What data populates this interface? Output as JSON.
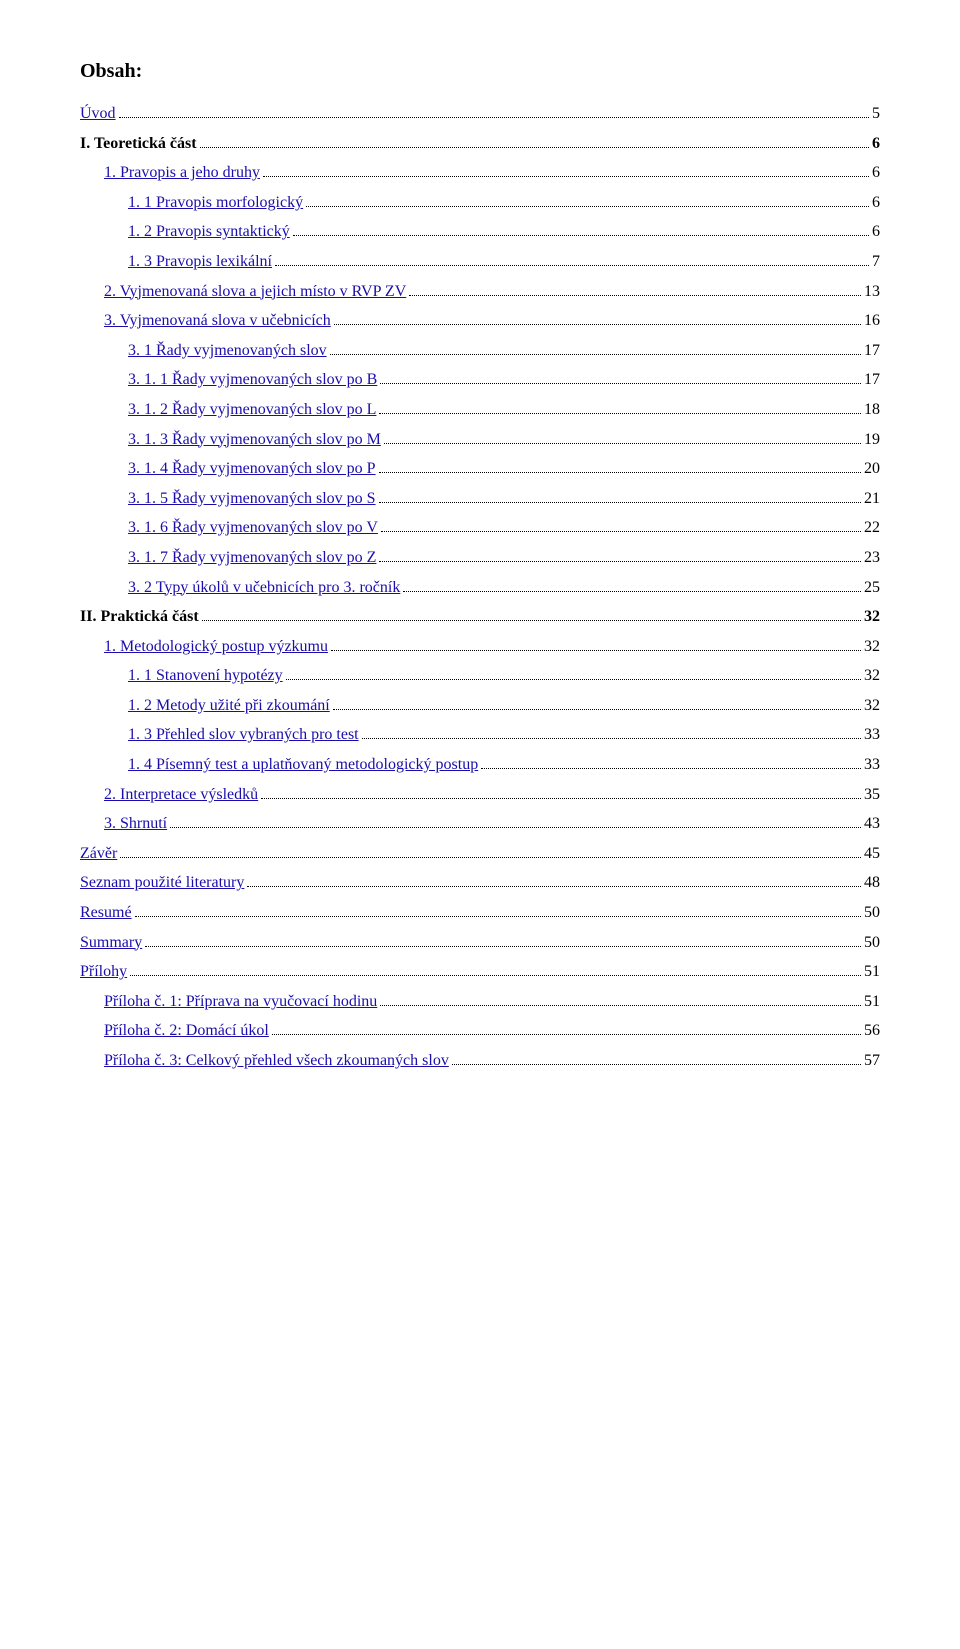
{
  "heading": "Obsah:",
  "entries": [
    {
      "label": "Úvod",
      "page": "5",
      "indent": 0,
      "bold": false,
      "link": true
    },
    {
      "label": "I. Teoretická část",
      "page": "6",
      "indent": 0,
      "bold": true,
      "link": false
    },
    {
      "label": "1. Pravopis a jeho druhy",
      "page": "6",
      "indent": 1,
      "bold": false,
      "link": true
    },
    {
      "label": "1. 1 Pravopis morfologický",
      "page": "6",
      "indent": 2,
      "bold": false,
      "link": true
    },
    {
      "label": "1. 2 Pravopis syntaktický",
      "page": "6",
      "indent": 2,
      "bold": false,
      "link": true
    },
    {
      "label": "1. 3 Pravopis lexikální",
      "page": "7",
      "indent": 2,
      "bold": false,
      "link": true
    },
    {
      "label": "2. Vyjmenovaná slova a jejich místo v RVP ZV",
      "page": "13",
      "indent": 1,
      "bold": false,
      "link": true
    },
    {
      "label": "3. Vyjmenovaná slova v učebnicích",
      "page": "16",
      "indent": 1,
      "bold": false,
      "link": true
    },
    {
      "label": "3. 1 Řady vyjmenovaných slov",
      "page": "17",
      "indent": 2,
      "bold": false,
      "link": true
    },
    {
      "label": "3. 1. 1 Řady vyjmenovaných slov po B",
      "page": "17",
      "indent": 2,
      "bold": false,
      "link": true
    },
    {
      "label": "3. 1. 2 Řady vyjmenovaných slov po L",
      "page": "18",
      "indent": 2,
      "bold": false,
      "link": true
    },
    {
      "label": "3. 1. 3 Řady vyjmenovaných slov po M",
      "page": "19",
      "indent": 2,
      "bold": false,
      "link": true
    },
    {
      "label": "3. 1. 4 Řady vyjmenovaných slov po P",
      "page": "20",
      "indent": 2,
      "bold": false,
      "link": true
    },
    {
      "label": "3. 1. 5 Řady vyjmenovaných slov po S",
      "page": "21",
      "indent": 2,
      "bold": false,
      "link": true
    },
    {
      "label": "3. 1. 6 Řady vyjmenovaných slov po V",
      "page": "22",
      "indent": 2,
      "bold": false,
      "link": true
    },
    {
      "label": "3. 1. 7 Řady vyjmenovaných slov po Z",
      "page": "23",
      "indent": 2,
      "bold": false,
      "link": true
    },
    {
      "label": "3. 2 Typy úkolů v učebnicích pro 3. ročník",
      "page": "25",
      "indent": 2,
      "bold": false,
      "link": true
    },
    {
      "label": "II. Praktická část",
      "page": "32",
      "indent": 0,
      "bold": true,
      "link": false
    },
    {
      "label": "1. Metodologický postup výzkumu",
      "page": "32",
      "indent": 1,
      "bold": false,
      "link": true
    },
    {
      "label": "1. 1 Stanovení hypotézy",
      "page": "32",
      "indent": 2,
      "bold": false,
      "link": true
    },
    {
      "label": "1. 2 Metody užité při zkoumání",
      "page": "32",
      "indent": 2,
      "bold": false,
      "link": true
    },
    {
      "label": "1. 3 Přehled slov vybraných pro test",
      "page": "33",
      "indent": 2,
      "bold": false,
      "link": true
    },
    {
      "label": "1. 4 Písemný test a uplatňovaný metodologický postup",
      "page": "33",
      "indent": 2,
      "bold": false,
      "link": true
    },
    {
      "label": "2. Interpretace výsledků",
      "page": "35",
      "indent": 1,
      "bold": false,
      "link": true
    },
    {
      "label": "3. Shrnutí",
      "page": "43",
      "indent": 1,
      "bold": false,
      "link": true
    },
    {
      "label": "Závěr",
      "page": "45",
      "indent": 0,
      "bold": false,
      "link": true
    },
    {
      "label": "Seznam použité literatury",
      "page": "48",
      "indent": 0,
      "bold": false,
      "link": true
    },
    {
      "label": "Resumé",
      "page": "50",
      "indent": 0,
      "bold": false,
      "link": true
    },
    {
      "label": "Summary",
      "page": "50",
      "indent": 0,
      "bold": false,
      "link": true
    },
    {
      "label": "Přílohy",
      "page": "51",
      "indent": 0,
      "bold": false,
      "link": true
    },
    {
      "label": "Příloha č. 1: Příprava na vyučovací hodinu",
      "page": "51",
      "indent": 1,
      "bold": false,
      "link": true
    },
    {
      "label": "Příloha č. 2: Domácí úkol",
      "page": "56",
      "indent": 1,
      "bold": false,
      "link": true
    },
    {
      "label": "Příloha č. 3: Celkový přehled všech zkoumaných slov",
      "page": "57",
      "indent": 1,
      "bold": false,
      "link": true
    }
  ]
}
